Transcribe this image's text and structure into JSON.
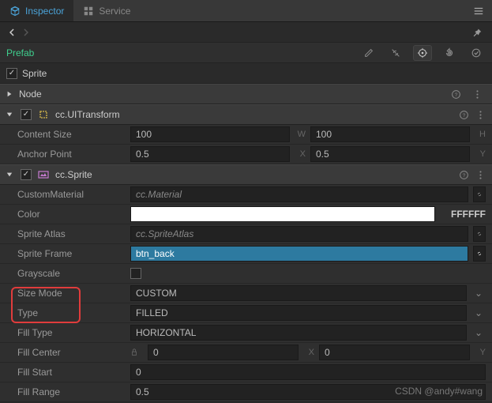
{
  "tabs": {
    "inspector": "Inspector",
    "service": "Service"
  },
  "prefab": {
    "label": "Prefab"
  },
  "node": {
    "checked": true,
    "name": "Sprite",
    "section_label": "Node"
  },
  "uitransform": {
    "title": "cc.UITransform",
    "content_size_label": "Content Size",
    "content_size_x": "100",
    "content_size_y": "100",
    "anchor_label": "Anchor Point",
    "anchor_x": "0.5",
    "anchor_y": "0.5",
    "axis_w": "W",
    "axis_h": "H",
    "axis_x": "X",
    "axis_y": "Y"
  },
  "sprite": {
    "title": "cc.Sprite",
    "custom_material_label": "CustomMaterial",
    "custom_material_value": "cc.Material",
    "color_label": "Color",
    "color_hex": "FFFFFF",
    "sprite_atlas_label": "Sprite Atlas",
    "sprite_atlas_value": "cc.SpriteAtlas",
    "sprite_frame_label": "Sprite Frame",
    "sprite_frame_value": "btn_back",
    "grayscale_label": "Grayscale",
    "size_mode_label": "Size Mode",
    "size_mode_value": "CUSTOM",
    "type_label": "Type",
    "type_value": "FILLED",
    "fill_type_label": "Fill Type",
    "fill_type_value": "HORIZONTAL",
    "fill_center_label": "Fill Center",
    "fill_center_x": "0",
    "fill_center_y": "0",
    "fill_start_label": "Fill Start",
    "fill_start_value": "0",
    "fill_range_label": "Fill Range",
    "fill_range_value": "0.5"
  },
  "watermark": "CSDN @andy#wang"
}
